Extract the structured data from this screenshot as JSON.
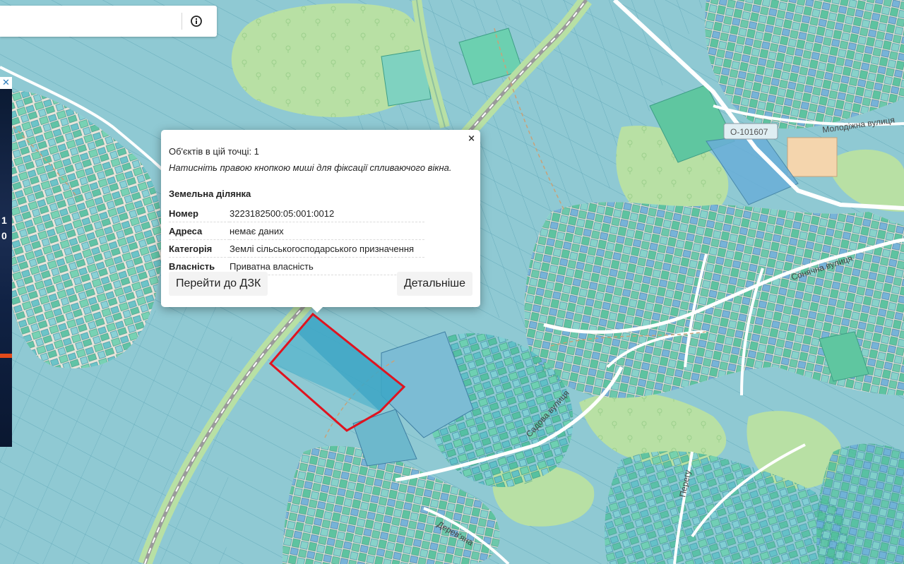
{
  "map": {
    "road_labels": [
      "О-101607",
      "Молодіжна вулиця",
      "Сонячна вулиця",
      "Садова вулиця",
      "Дерев'яна",
      "Перегу"
    ],
    "colors": {
      "parcel_fill": "#8fc9d3",
      "parcel_stroke": "#5aa3b4",
      "parcel_dark": "#4ab0cc",
      "green_parcel": "#6cd0b0",
      "forest": "#b8e0a4",
      "selection_outline": "#e0131f"
    }
  },
  "search": {
    "info_icon": "info-icon"
  },
  "ad": {
    "close_glyph": "✕",
    "text": [
      "1",
      "0"
    ]
  },
  "popup": {
    "close_glyph": "×",
    "objects_count": "Об'єктів в цій точці: 1",
    "hint": "Натисніть правою кнопкою миші для фіксації спливаючого вікна.",
    "section_title": "Земельна ділянка",
    "rows": [
      {
        "key": "Номер",
        "value": "3223182500:05:001:0012"
      },
      {
        "key": "Адреса",
        "value": "немає даних"
      },
      {
        "key": "Категорія",
        "value": "Землі сільськогосподарського призначення"
      },
      {
        "key": "Власність",
        "value": "Приватна власність"
      }
    ],
    "button_dzk": "Перейти до ДЗК",
    "button_details": "Детальніше"
  }
}
